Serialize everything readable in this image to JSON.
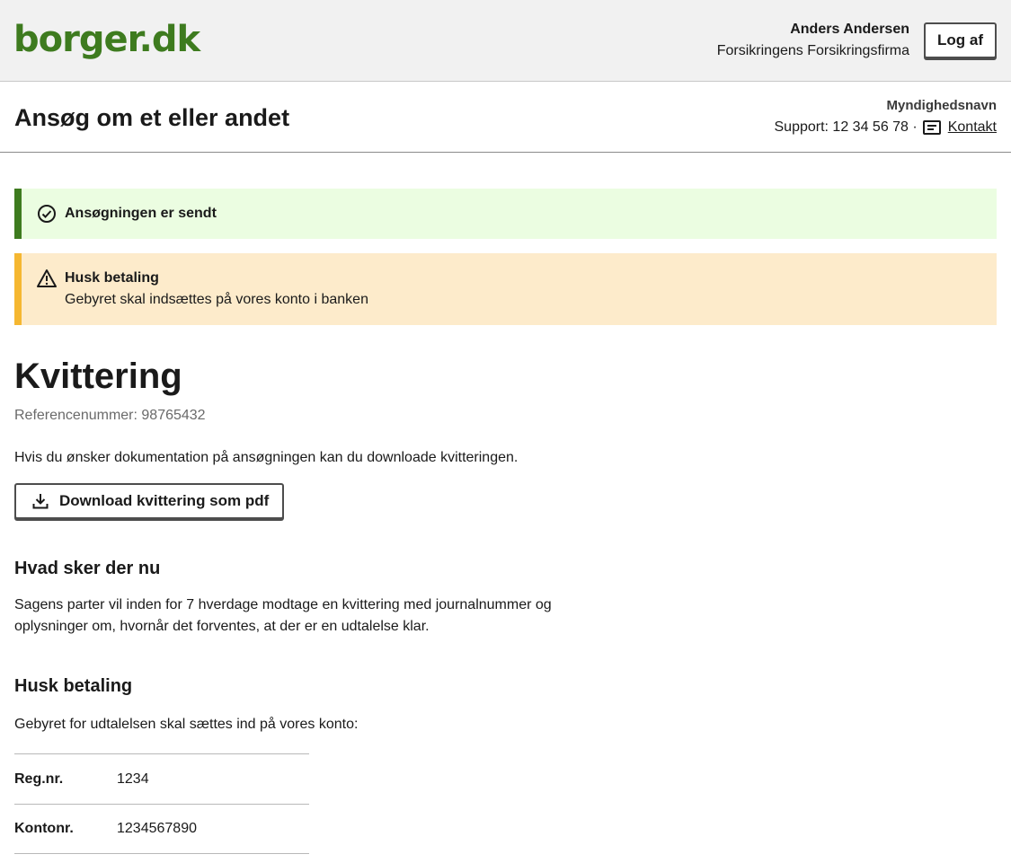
{
  "header": {
    "logo": "borger.dk",
    "user_name": "Anders Andersen",
    "user_org": "Forsikringens Forsikringsfirma",
    "logout_label": "Log af"
  },
  "service": {
    "title": "Ansøg om et eller andet",
    "authority": "Myndighedsnavn",
    "support": "Support: 12 34 56 78 ·",
    "contact_label": "Kontakt"
  },
  "alerts": {
    "success_title": "Ansøgningen er sendt",
    "warning_title": "Husk betaling",
    "warning_text": "Gebyret skal indsættes på vores konto i banken"
  },
  "receipt": {
    "title": "Kvittering",
    "reference": "Referencenummer: 98765432",
    "doc_text": "Hvis du ønsker dokumentation på ansøgningen kan du downloade kvitteringen.",
    "download_label": "Download kvittering som pdf"
  },
  "next": {
    "heading": "Hvad sker der nu",
    "text": "Sagens parter vil inden for 7 hverdage modtage en kvittering med journalnummer og oplysninger om, hvornår det forventes, at der er en udtalelse klar."
  },
  "payment": {
    "heading": "Husk betaling",
    "text": "Gebyret for udtalelsen skal sættes ind på vores konto:",
    "rows": [
      {
        "label": "Reg.nr.",
        "value": "1234"
      },
      {
        "label": "Kontonr.",
        "value": "1234567890"
      }
    ]
  },
  "colors": {
    "brand": "#3e7b1f",
    "success_bg": "#ebfde1",
    "warning_bg": "#fdebcb",
    "warning_border": "#f5b731"
  },
  "icons": {
    "success": "check-circle-icon",
    "warning": "warning-triangle-icon",
    "contact": "message-icon",
    "download": "download-icon"
  }
}
